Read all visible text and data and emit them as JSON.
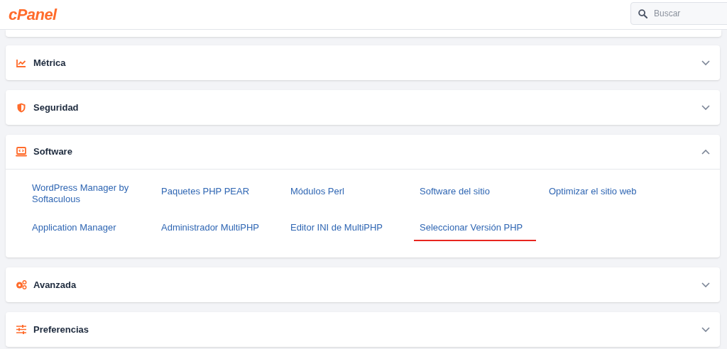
{
  "header": {
    "logo": "cPanel",
    "search": {
      "placeholder": "Buscar"
    }
  },
  "sections": [
    {
      "title": "Métrica",
      "expanded": false
    },
    {
      "title": "Seguridad",
      "expanded": false
    },
    {
      "title": "Software",
      "expanded": true,
      "items": [
        {
          "label": "WordPress Manager by Softaculous",
          "highlighted": false
        },
        {
          "label": "Paquetes PHP PEAR",
          "highlighted": false
        },
        {
          "label": "Módulos Perl",
          "highlighted": false
        },
        {
          "label": "Software del sitio",
          "highlighted": false
        },
        {
          "label": "Optimizar el sitio web",
          "highlighted": false
        },
        {
          "label": "Application Manager",
          "highlighted": false
        },
        {
          "label": "Administrador MultiPHP",
          "highlighted": false
        },
        {
          "label": "Editor INI de MultiPHP",
          "highlighted": false
        },
        {
          "label": "Seleccionar Versión PHP",
          "highlighted": true
        }
      ]
    },
    {
      "title": "Avanzada",
      "expanded": false
    },
    {
      "title": "Preferencias",
      "expanded": false
    }
  ]
}
